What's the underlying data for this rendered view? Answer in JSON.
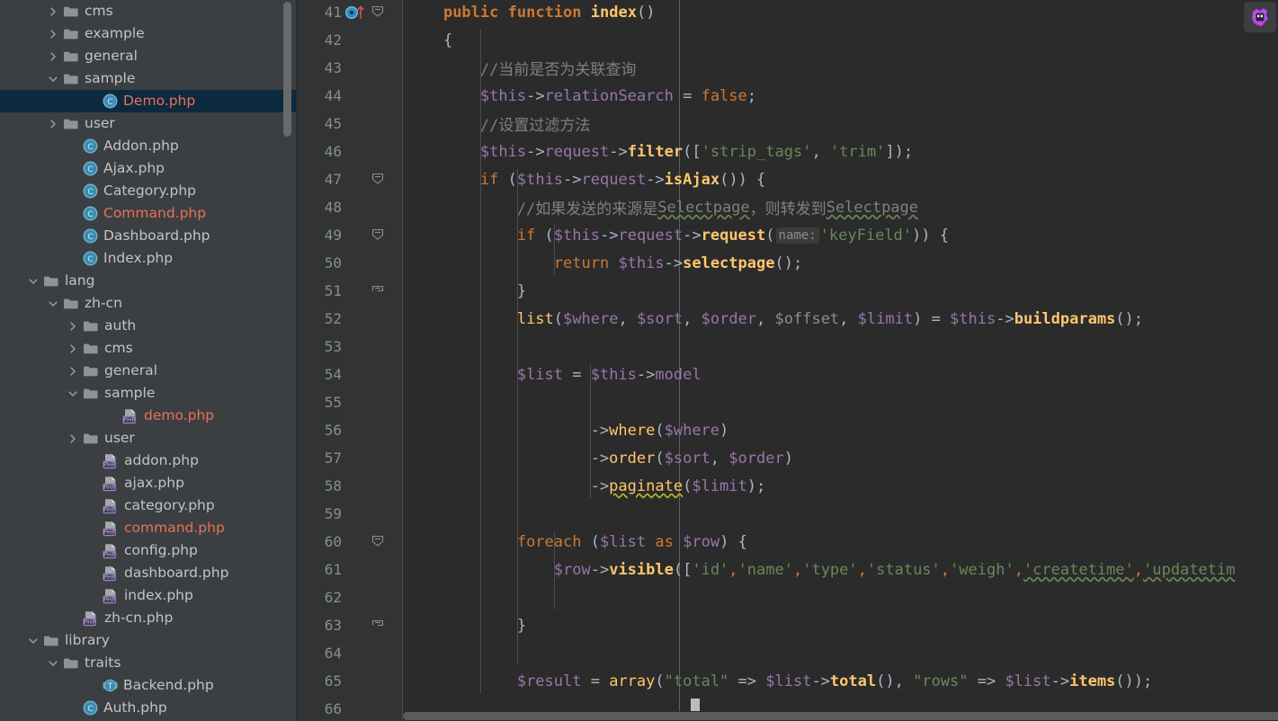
{
  "window": {
    "theme_background": "#2b2b2b",
    "sidebar_background": "#3c3f41",
    "selection_background": "#0d293e",
    "accent_error_color": "#e8705a"
  },
  "sidebar": {
    "name": "project-tree",
    "scrollbar_visible": true,
    "items": [
      {
        "label": "cms",
        "icon": "folder-icon",
        "arrow": "chevron-right",
        "indent": 2,
        "color": "grey",
        "selected": false
      },
      {
        "label": "example",
        "icon": "folder-icon",
        "arrow": "chevron-right",
        "indent": 2,
        "color": "grey",
        "selected": false
      },
      {
        "label": "general",
        "icon": "folder-icon",
        "arrow": "chevron-right",
        "indent": 2,
        "color": "grey",
        "selected": false
      },
      {
        "label": "sample",
        "icon": "folder-icon",
        "arrow": "chevron-down",
        "indent": 2,
        "color": "grey",
        "selected": false
      },
      {
        "label": "Demo.php",
        "icon": "php-class-icon",
        "arrow": "none",
        "indent": 4,
        "color": "red",
        "selected": true
      },
      {
        "label": "user",
        "icon": "folder-icon",
        "arrow": "chevron-right",
        "indent": 2,
        "color": "grey",
        "selected": false
      },
      {
        "label": "Addon.php",
        "icon": "php-class-icon",
        "arrow": "none",
        "indent": 3,
        "color": "grey",
        "selected": false
      },
      {
        "label": "Ajax.php",
        "icon": "php-class-icon",
        "arrow": "none",
        "indent": 3,
        "color": "grey",
        "selected": false
      },
      {
        "label": "Category.php",
        "icon": "php-class-icon",
        "arrow": "none",
        "indent": 3,
        "color": "grey",
        "selected": false
      },
      {
        "label": "Command.php",
        "icon": "php-class-icon",
        "arrow": "none",
        "indent": 3,
        "color": "red",
        "selected": false
      },
      {
        "label": "Dashboard.php",
        "icon": "php-class-icon",
        "arrow": "none",
        "indent": 3,
        "color": "grey",
        "selected": false
      },
      {
        "label": "Index.php",
        "icon": "php-class-icon",
        "arrow": "none",
        "indent": 3,
        "color": "grey",
        "selected": false
      },
      {
        "label": "lang",
        "icon": "folder-icon",
        "arrow": "chevron-down",
        "indent": 1,
        "color": "grey",
        "selected": false
      },
      {
        "label": "zh-cn",
        "icon": "folder-icon",
        "arrow": "chevron-down",
        "indent": 2,
        "color": "grey",
        "selected": false
      },
      {
        "label": "auth",
        "icon": "folder-icon",
        "arrow": "chevron-right",
        "indent": 3,
        "color": "grey",
        "selected": false
      },
      {
        "label": "cms",
        "icon": "folder-icon",
        "arrow": "chevron-right",
        "indent": 3,
        "color": "grey",
        "selected": false
      },
      {
        "label": "general",
        "icon": "folder-icon",
        "arrow": "chevron-right",
        "indent": 3,
        "color": "grey",
        "selected": false
      },
      {
        "label": "sample",
        "icon": "folder-icon",
        "arrow": "chevron-down",
        "indent": 3,
        "color": "grey",
        "selected": false
      },
      {
        "label": "demo.php",
        "icon": "php-file-icon",
        "arrow": "none",
        "indent": 5,
        "color": "red",
        "selected": false
      },
      {
        "label": "user",
        "icon": "folder-icon",
        "arrow": "chevron-right",
        "indent": 3,
        "color": "grey",
        "selected": false
      },
      {
        "label": "addon.php",
        "icon": "php-file-icon",
        "arrow": "none",
        "indent": 4,
        "color": "grey",
        "selected": false
      },
      {
        "label": "ajax.php",
        "icon": "php-file-icon",
        "arrow": "none",
        "indent": 4,
        "color": "grey",
        "selected": false
      },
      {
        "label": "category.php",
        "icon": "php-file-icon",
        "arrow": "none",
        "indent": 4,
        "color": "grey",
        "selected": false
      },
      {
        "label": "command.php",
        "icon": "php-file-icon",
        "arrow": "none",
        "indent": 4,
        "color": "red",
        "selected": false
      },
      {
        "label": "config.php",
        "icon": "php-file-icon",
        "arrow": "none",
        "indent": 4,
        "color": "grey",
        "selected": false
      },
      {
        "label": "dashboard.php",
        "icon": "php-file-icon",
        "arrow": "none",
        "indent": 4,
        "color": "grey",
        "selected": false
      },
      {
        "label": "index.php",
        "icon": "php-file-icon",
        "arrow": "none",
        "indent": 4,
        "color": "grey",
        "selected": false
      },
      {
        "label": "zh-cn.php",
        "icon": "php-file-icon",
        "arrow": "none",
        "indent": 3,
        "color": "grey",
        "selected": false
      },
      {
        "label": "library",
        "icon": "folder-icon",
        "arrow": "chevron-down",
        "indent": 1,
        "color": "grey",
        "selected": false
      },
      {
        "label": "traits",
        "icon": "folder-icon",
        "arrow": "chevron-down",
        "indent": 2,
        "color": "grey",
        "selected": false
      },
      {
        "label": "Backend.php",
        "icon": "php-trait-icon",
        "arrow": "none",
        "indent": 4,
        "color": "grey",
        "selected": false
      },
      {
        "label": "Auth.php",
        "icon": "php-class-icon",
        "arrow": "none",
        "indent": 3,
        "color": "grey",
        "selected": false
      }
    ]
  },
  "toolbar": {
    "assistant_label": "AI Assistant",
    "assistant_icon": "ai-assistant-icon"
  },
  "editor": {
    "name": "code-editor",
    "language": "PHP",
    "first_visible_line": 41,
    "last_visible_line": 66,
    "caret": {
      "line": 66,
      "column": 1
    },
    "gutter": {
      "line_numbers": [
        41,
        42,
        43,
        44,
        45,
        46,
        47,
        48,
        49,
        50,
        51,
        52,
        53,
        54,
        55,
        56,
        57,
        58,
        59,
        60,
        61,
        62,
        63,
        64,
        65,
        66
      ],
      "markers": [
        {
          "line": 41,
          "icon": "method-override-icon"
        },
        {
          "line": 41,
          "icon": "override-arrow-icon"
        }
      ],
      "fold_markers": [
        {
          "line": 41,
          "state": "expanded",
          "icon": "fold-minus-icon"
        },
        {
          "line": 47,
          "state": "expanded",
          "icon": "fold-minus-icon"
        },
        {
          "line": 49,
          "state": "expanded",
          "icon": "fold-minus-icon"
        },
        {
          "line": 51,
          "state": "end",
          "icon": "fold-end-icon"
        },
        {
          "line": 60,
          "state": "expanded",
          "icon": "fold-minus-icon"
        },
        {
          "line": 63,
          "state": "end",
          "icon": "fold-end-icon"
        }
      ]
    },
    "lines": [
      {
        "n": 41,
        "text": "    public function index()"
      },
      {
        "n": 42,
        "text": "    {"
      },
      {
        "n": 43,
        "text": "        //当前是否为关联查询"
      },
      {
        "n": 44,
        "text": "        $this->relationSearch = false;"
      },
      {
        "n": 45,
        "text": "        //设置过滤方法"
      },
      {
        "n": 46,
        "text": "        $this->request->filter(['strip_tags', 'trim']);"
      },
      {
        "n": 47,
        "text": "        if ($this->request->isAjax()) {"
      },
      {
        "n": 48,
        "text": "            //如果发送的来源是Selectpage，则转发到Selectpage"
      },
      {
        "n": 49,
        "text": "            if ($this->request->request( name: 'keyField')) {"
      },
      {
        "n": 50,
        "text": "                return $this->selectpage();"
      },
      {
        "n": 51,
        "text": "            }"
      },
      {
        "n": 52,
        "text": "            list($where, $sort, $order, $offset, $limit) = $this->buildparams();"
      },
      {
        "n": 53,
        "text": ""
      },
      {
        "n": 54,
        "text": "            $list = $this->model"
      },
      {
        "n": 55,
        "text": ""
      },
      {
        "n": 56,
        "text": "                    ->where($where)"
      },
      {
        "n": 57,
        "text": "                    ->order($sort, $order)"
      },
      {
        "n": 58,
        "text": "                    ->paginate($limit);"
      },
      {
        "n": 59,
        "text": ""
      },
      {
        "n": 60,
        "text": "            foreach ($list as $row) {"
      },
      {
        "n": 61,
        "text": "                $row->visible(['id','name','type','status','weigh','createtime','updatetim"
      },
      {
        "n": 62,
        "text": ""
      },
      {
        "n": 63,
        "text": "            }"
      },
      {
        "n": 64,
        "text": ""
      },
      {
        "n": 65,
        "text": "            $result = array(\"total\" => $list->total(), \"rows\" => $list->items());"
      },
      {
        "n": 66,
        "text": ""
      }
    ],
    "inlay_hints": [
      {
        "line": 49,
        "text": "name:"
      }
    ],
    "horizontal_scrollbar": {
      "visible": true,
      "thumb_fraction": 0.78
    }
  }
}
